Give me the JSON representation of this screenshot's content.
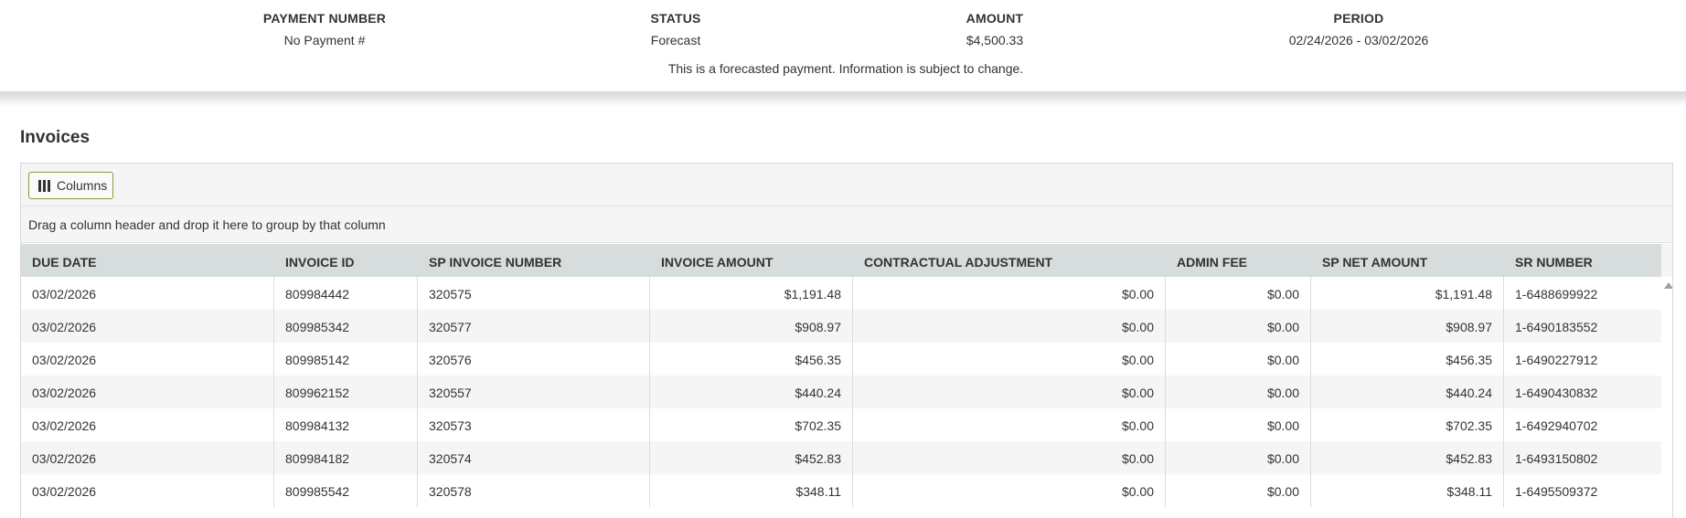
{
  "summary": {
    "payment_number": {
      "label": "PAYMENT NUMBER",
      "value": "No Payment #"
    },
    "status": {
      "label": "STATUS",
      "value": "Forecast"
    },
    "amount": {
      "label": "AMOUNT",
      "value": "$4,500.33"
    },
    "period": {
      "label": "PERIOD",
      "value": "02/24/2026 - 03/02/2026"
    },
    "note": "This is a forecasted payment. Information is subject to change."
  },
  "invoices": {
    "title": "Invoices",
    "columns_button_label": "Columns",
    "columns_icon": "columns-icon",
    "group_hint": "Drag a column header and drop it here to group by that column",
    "headers": [
      "DUE DATE",
      "INVOICE ID",
      "SP INVOICE NUMBER",
      "INVOICE AMOUNT",
      "CONTRACTUAL ADJUSTMENT",
      "ADMIN FEE",
      "SP NET AMOUNT",
      "SR NUMBER"
    ],
    "rows": [
      [
        "03/02/2026",
        "809984442",
        "320575",
        "$1,191.48",
        "$0.00",
        "$0.00",
        "$1,191.48",
        "1-6488699922"
      ],
      [
        "03/02/2026",
        "809985342",
        "320577",
        "$908.97",
        "$0.00",
        "$0.00",
        "$908.97",
        "1-6490183552"
      ],
      [
        "03/02/2026",
        "809985142",
        "320576",
        "$456.35",
        "$0.00",
        "$0.00",
        "$456.35",
        "1-6490227912"
      ],
      [
        "03/02/2026",
        "809962152",
        "320557",
        "$440.24",
        "$0.00",
        "$0.00",
        "$440.24",
        "1-6490430832"
      ],
      [
        "03/02/2026",
        "809984132",
        "320573",
        "$702.35",
        "$0.00",
        "$0.00",
        "$702.35",
        "1-6492940702"
      ],
      [
        "03/02/2026",
        "809984182",
        "320574",
        "$452.83",
        "$0.00",
        "$0.00",
        "$452.83",
        "1-6493150802"
      ],
      [
        "03/02/2026",
        "809985542",
        "320578",
        "$348.11",
        "$0.00",
        "$0.00",
        "$348.11",
        "1-6495509372"
      ]
    ]
  },
  "colors": {
    "header_bg": "#d7dcdc",
    "alt_row_bg": "#f5f5f5",
    "button_border": "#8a9a3f"
  }
}
